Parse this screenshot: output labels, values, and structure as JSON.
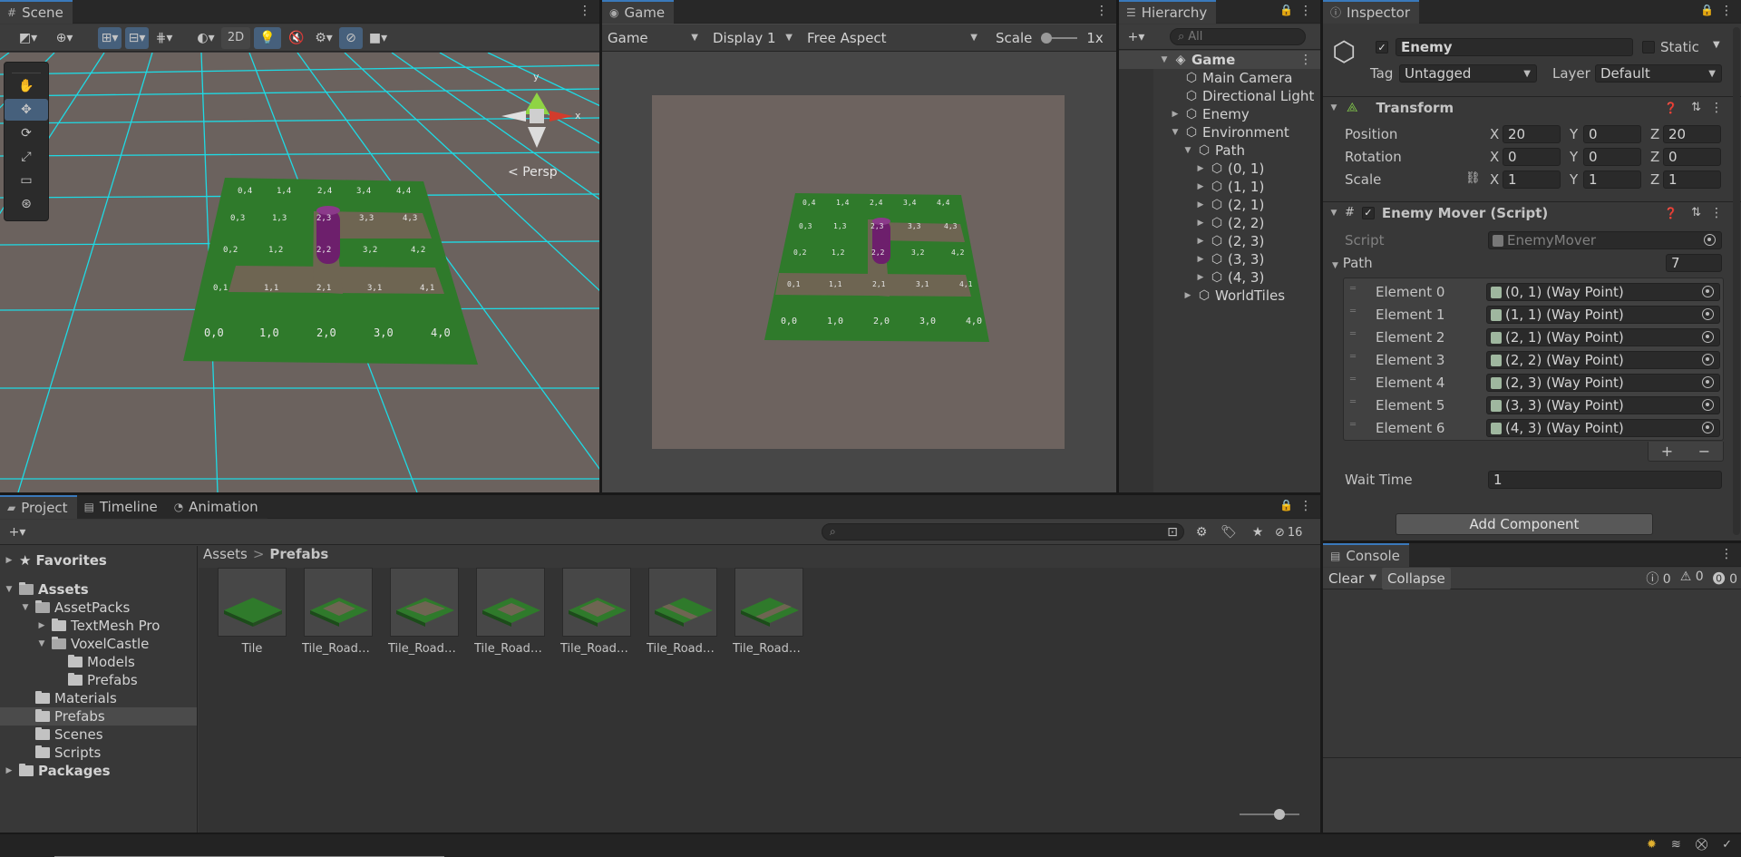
{
  "scene": {
    "tab": "Scene",
    "toolbar": {
      "mode2d": "2D"
    },
    "persp_label": "Persp",
    "gizmo": {
      "y": "y",
      "x": "x"
    },
    "tile_labels": [
      "0,4",
      "1,4",
      "2,4",
      "3,4",
      "4,4",
      "0,3",
      "1,3",
      "2,3",
      "3,3",
      "4,3",
      "0,2",
      "1,2",
      "2,2",
      "3,2",
      "4,2",
      "0,1",
      "1,1",
      "2,1",
      "3,1",
      "4,1",
      "0,0",
      "1,0",
      "2,0",
      "3,0",
      "4,0"
    ]
  },
  "game": {
    "tab": "Game",
    "toolbar": {
      "display_mode": "Game",
      "display": "Display 1",
      "aspect": "Free Aspect",
      "scale_label": "Scale",
      "scale_value": "1x"
    }
  },
  "hierarchy": {
    "tab": "Hierarchy",
    "search_placeholder": "All",
    "scene_root": "Game",
    "items": [
      "Main Camera",
      "Directional Light",
      "Enemy",
      "Environment",
      "Path",
      "(0, 1)",
      "(1, 1)",
      "(2, 1)",
      "(2, 2)",
      "(2, 3)",
      "(3, 3)",
      "(4, 3)",
      "WorldTiles"
    ]
  },
  "inspector": {
    "tab": "Inspector",
    "object_name": "Enemy",
    "static_label": "Static",
    "tag_label": "Tag",
    "tag_value": "Untagged",
    "layer_label": "Layer",
    "layer_value": "Default",
    "transform": {
      "title": "Transform",
      "position_label": "Position",
      "rotation_label": "Rotation",
      "scale_label": "Scale",
      "x": "X",
      "y": "Y",
      "z": "Z",
      "position": [
        "20",
        "0",
        "20"
      ],
      "rotation": [
        "0",
        "0",
        "0"
      ],
      "scale": [
        "1",
        "1",
        "1"
      ]
    },
    "mover": {
      "title": "Enemy Mover (Script)",
      "script_label": "Script",
      "script_value": "EnemyMover",
      "path_label": "Path",
      "path_count": "7",
      "elements": [
        {
          "label": "Element 0",
          "value": "(0, 1) (Way Point)"
        },
        {
          "label": "Element 1",
          "value": "(1, 1) (Way Point)"
        },
        {
          "label": "Element 2",
          "value": "(2, 1) (Way Point)"
        },
        {
          "label": "Element 3",
          "value": "(2, 2) (Way Point)"
        },
        {
          "label": "Element 4",
          "value": "(2, 3) (Way Point)"
        },
        {
          "label": "Element 5",
          "value": "(3, 3) (Way Point)"
        },
        {
          "label": "Element 6",
          "value": "(4, 3) (Way Point)"
        }
      ],
      "add": "+",
      "remove": "−",
      "wait_label": "Wait Time",
      "wait_value": "1"
    },
    "add_component": "Add Component"
  },
  "project": {
    "tabs": [
      "Project",
      "Timeline",
      "Animation"
    ],
    "hidden_count": "16",
    "tree": [
      "Favorites",
      "Assets",
      "AssetPacks",
      "TextMesh Pro",
      "VoxelCastle",
      "Models",
      "Prefabs",
      "Materials",
      "Prefabs",
      "Scenes",
      "Scripts",
      "Packages"
    ],
    "breadcrumb": [
      "Assets",
      "Prefabs"
    ],
    "assets": [
      "Tile",
      "Tile_RoadC...",
      "Tile_RoadC...",
      "Tile_RoadC...",
      "Tile_RoadC...",
      "Tile_RoadS...",
      "Tile_RoadS..."
    ]
  },
  "console": {
    "tab": "Console",
    "clear": "Clear",
    "collapse": "Collapse",
    "counts": [
      "0",
      "0",
      "0"
    ]
  },
  "colors": {
    "accent": "#3a79bb",
    "grass": "#2f7d2a",
    "path": "#7a6e5c",
    "grid": "#00e5ff",
    "enemy": "#7a2a7a"
  }
}
